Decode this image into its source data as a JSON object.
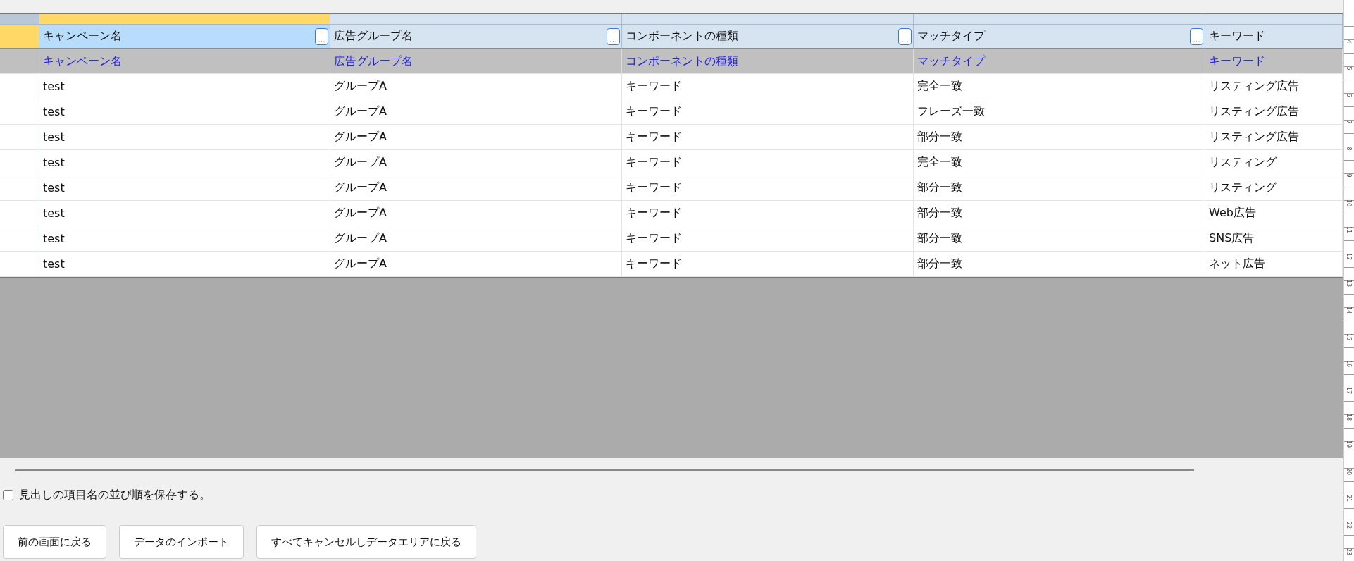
{
  "columns": [
    {
      "title": "キャンペーン名",
      "selected": true,
      "filter": "キャンペーン名",
      "picker": "..."
    },
    {
      "title": "広告グループ名",
      "selected": false,
      "filter": "広告グループ名",
      "picker": "..."
    },
    {
      "title": "コンポーネントの種類",
      "selected": false,
      "filter": "コンポーネントの種類",
      "picker": "..."
    },
    {
      "title": "マッチタイプ",
      "selected": false,
      "filter": "マッチタイプ",
      "picker": "..."
    },
    {
      "title": "キーワード",
      "selected": false,
      "filter": "キーワード"
    }
  ],
  "rows": [
    [
      "test",
      "グループA",
      "キーワード",
      "完全一致",
      "リスティング広告"
    ],
    [
      "test",
      "グループA",
      "キーワード",
      "フレーズ一致",
      "リスティング広告"
    ],
    [
      "test",
      "グループA",
      "キーワード",
      "部分一致",
      "リスティング広告"
    ],
    [
      "test",
      "グループA",
      "キーワード",
      "完全一致",
      "リスティング"
    ],
    [
      "test",
      "グループA",
      "キーワード",
      "部分一致",
      "リスティング"
    ],
    [
      "test",
      "グループA",
      "キーワード",
      "部分一致",
      "Web広告"
    ],
    [
      "test",
      "グループA",
      "キーワード",
      "部分一致",
      "SNS広告"
    ],
    [
      "test",
      "グループA",
      "キーワード",
      "部分一致",
      "ネット広告"
    ]
  ],
  "save_order": {
    "label": "見出しの項目名の並び順を保存する。",
    "checked": false
  },
  "buttons": [
    "前の画面に戻る",
    "データのインポート",
    "すべてキャンセルしデータエリアに戻る"
  ],
  "ruler": {
    "labels": [
      "4",
      "5",
      "6",
      "7",
      "8",
      "9",
      "10",
      "11",
      "12",
      "13",
      "14",
      "15",
      "16",
      "17",
      "18",
      "19",
      "20",
      "21",
      "22",
      "23"
    ]
  }
}
